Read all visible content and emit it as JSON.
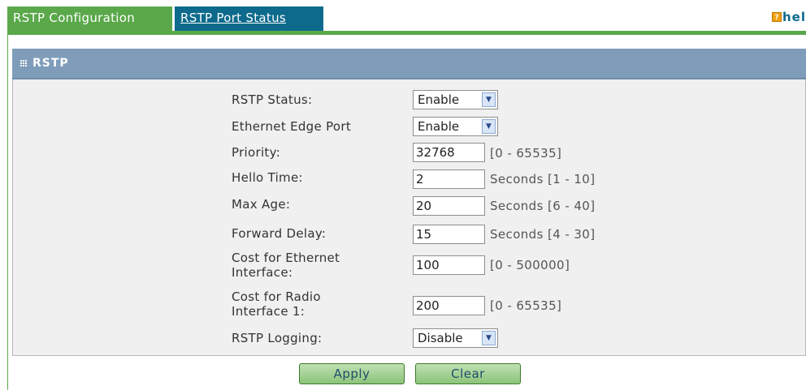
{
  "tabs": {
    "config": "RSTP Configuration",
    "status": "RSTP Port Status",
    "help": "hel",
    "help_glyph": "?"
  },
  "section": {
    "title": "RSTP"
  },
  "form": {
    "rstp_status": {
      "label": "RSTP Status:",
      "value": "Enable"
    },
    "edge_port": {
      "label": "Ethernet Edge Port",
      "value": "Enable"
    },
    "priority": {
      "label": "Priority:",
      "value": "32768",
      "hint": "[0 - 65535]"
    },
    "hello_time": {
      "label": "Hello Time:",
      "value": "2",
      "hint": "Seconds [1 - 10]"
    },
    "max_age": {
      "label": "Max Age:",
      "value": "20",
      "hint": "Seconds [6 - 40]"
    },
    "forward_delay": {
      "label": "Forward Delay:",
      "value": "15",
      "hint": "Seconds [4 - 30]"
    },
    "cost_ethernet": {
      "label_line1": "Cost for Ethernet",
      "label_line2": "Interface:",
      "value": "100",
      "hint": "[0 - 500000]"
    },
    "cost_radio": {
      "label_line1": "Cost for Radio",
      "label_line2": "Interface 1:",
      "value": "200",
      "hint": "[0 - 65535]"
    },
    "logging": {
      "label": "RSTP Logging:",
      "value": "Disable"
    }
  },
  "buttons": {
    "apply": "Apply",
    "clear": "Clear"
  },
  "colors": {
    "tab_green": "#5aa84a",
    "tab_blue": "#0d6a8c",
    "header": "#7f9dba"
  }
}
